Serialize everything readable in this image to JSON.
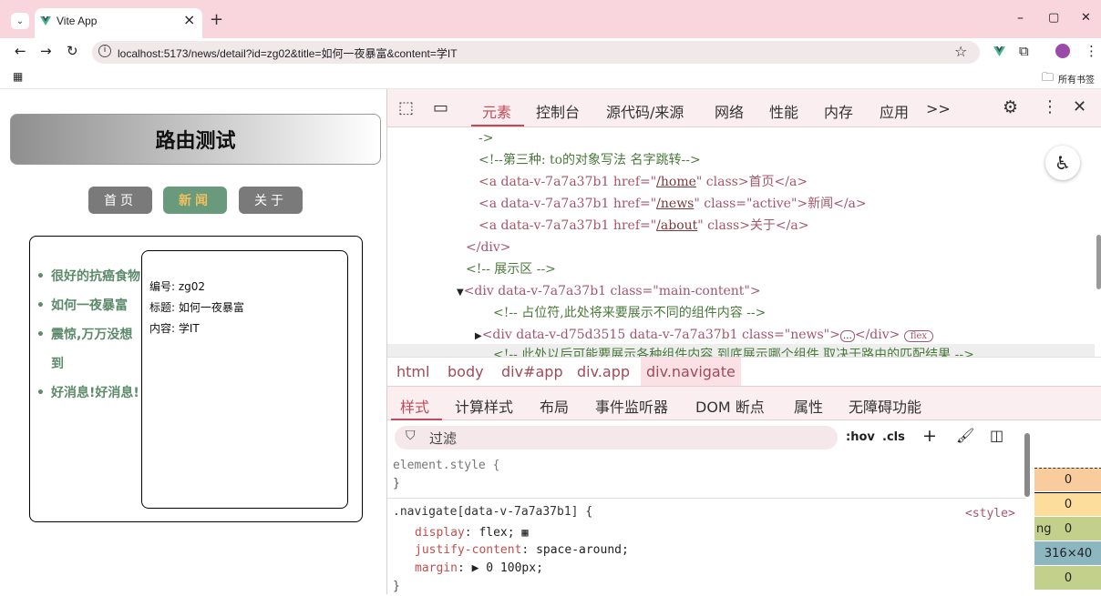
{
  "browser": {
    "tab_title": "Vite App",
    "tab_close": "×",
    "new_tab": "+",
    "url": "localhost:5173/news/detail?id=zg02&title=如何一夜暴富&content=学IT",
    "bookmarks_label": "所有书签",
    "window_minimize": "–",
    "window_maximize": "▢",
    "window_close": "✕"
  },
  "page": {
    "title": "路由测试",
    "nav": [
      {
        "label": "首页",
        "active": false
      },
      {
        "label": "新闻",
        "active": true
      },
      {
        "label": "关于",
        "active": false
      }
    ],
    "news": [
      "很好的抗癌食物",
      "如何一夜暴富",
      "震惊,万万没想到",
      "好消息!好消息!"
    ],
    "detail": {
      "id_line": "编号: zg02",
      "title_line": "标题: 如何一夜暴富",
      "content_line": "内容: 学IT"
    }
  },
  "devtools": {
    "tabs": [
      "元素",
      "控制台",
      "源代码/来源",
      "网络",
      "性能",
      "内存",
      "应用"
    ],
    "more": ">>",
    "dom": {
      "l0": "->",
      "l1": "<!--第三种: to的对象写法 名字跳转-->",
      "a1_tag": "<a data-v-7a7a37b1 href=\"",
      "a1_href": "/home",
      "a1_rest": "\" class>首页</a>",
      "a2_tag": "<a data-v-7a7a37b1 href=\"",
      "a2_href": "/news",
      "a2_rest": "\" class=\"active\">新闻</a>",
      "a3_tag": "<a data-v-7a7a37b1 href=\"",
      "a3_href": "/about",
      "a3_rest": "\" class>关于</a>",
      "l5": "</div>",
      "l6": "<!-- 展示区 -->",
      "l7": "<div data-v-7a7a37b1 class=\"main-content\">",
      "l8": "<!-- 占位符,此处将来要展示不同的组件内容 -->",
      "l9": "<div data-v-d75d3515 data-v-7a7a37b1 class=\"news\">",
      "l9_ellipsis": "…",
      "l9_end": "</div>",
      "flex_badge": "flex",
      "l10": "<!-- 此处以后可能要展示各种组件内容 到底展示哪个组件 取决于路由的匹配结果 -->"
    },
    "breadcrumbs": [
      "html",
      "body",
      "div#app",
      "div.app",
      "div.navigate"
    ],
    "subtabs": [
      "样式",
      "计算样式",
      "布局",
      "事件监听器",
      "DOM 断点",
      "属性",
      "无障碍功能"
    ],
    "filter_placeholder": "过滤",
    "hov": ":hov",
    "cls": ".cls",
    "styles": {
      "element_style": "element.style {",
      "close1": "}",
      "selector": ".navigate[data-v-7a7a37b1] {",
      "source": "<style>",
      "p1_name": "display",
      "p1_val": "flex;",
      "p2_name": "justify-content",
      "p2_val": "space-around;",
      "p3_name": "margin",
      "p3_val": "▶ 0 100px;",
      "close2": "}"
    },
    "boxmodel": [
      "0",
      "0",
      "0",
      "316×40",
      "0"
    ],
    "boxmodel_label": "ng"
  }
}
